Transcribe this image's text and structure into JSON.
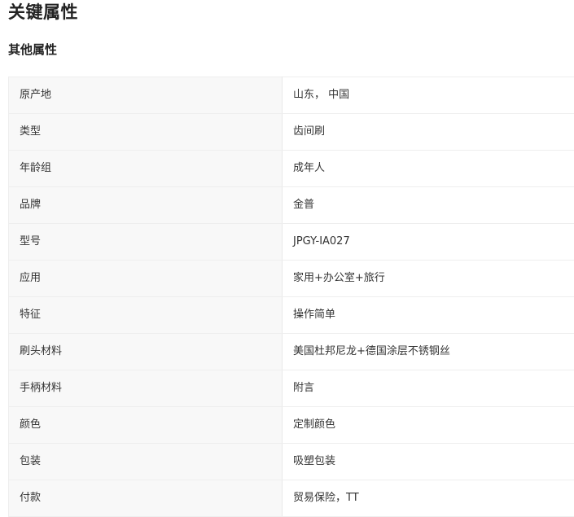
{
  "page": {
    "title": "关键属性",
    "subtitle": "其他属性"
  },
  "attributes": [
    {
      "name": "原产地",
      "value": "山东， 中国"
    },
    {
      "name": "类型",
      "value": "齿间刷"
    },
    {
      "name": "年龄组",
      "value": "成年人"
    },
    {
      "name": "品牌",
      "value": "金普"
    },
    {
      "name": "型号",
      "value": "JPGY-IA027"
    },
    {
      "name": "应用",
      "value": "家用+办公室+旅行"
    },
    {
      "name": "特征",
      "value": "操作简单"
    },
    {
      "name": "刷头材料",
      "value": "美国杜邦尼龙+德国涂层不锈钢丝"
    },
    {
      "name": "手柄材料",
      "value": "附言"
    },
    {
      "name": "颜色",
      "value": "定制颜色"
    },
    {
      "name": "包装",
      "value": "吸塑包装"
    },
    {
      "name": "付款",
      "value": "贸易保险，TT"
    }
  ],
  "colors": {
    "text": "#333333",
    "heading": "#222222",
    "name_cell_background": "#f8f8f8",
    "border": "#eeeeee"
  }
}
